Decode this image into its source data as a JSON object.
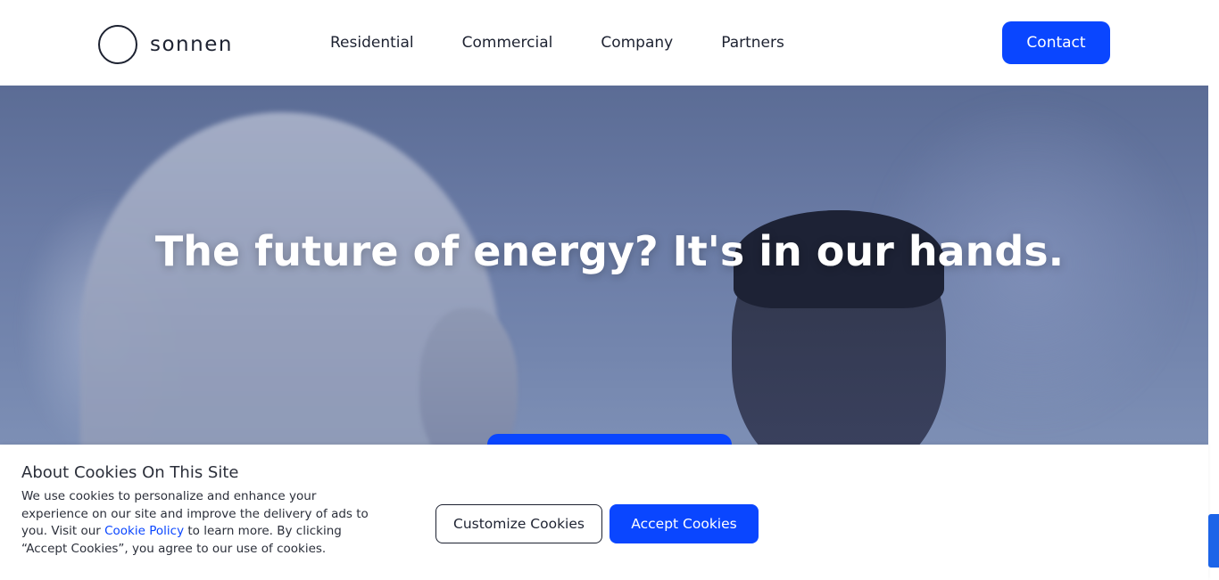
{
  "header": {
    "logo_text": "sonnen",
    "nav": [
      {
        "label": "Residential"
      },
      {
        "label": "Commercial"
      },
      {
        "label": "Company"
      },
      {
        "label": "Partners"
      }
    ],
    "contact_label": "Contact"
  },
  "hero": {
    "headline": "The future of energy? It's in our hands."
  },
  "cookie_banner": {
    "title": "About Cookies On This Site",
    "text_before_link": "We use cookies to personalize and enhance your experience on our site and improve the delivery of ads to you. Visit our ",
    "link_label": "Cookie Policy",
    "text_after_link": " to learn more. By clicking “Accept Cookies”, you agree to our use of cookies.",
    "customize_label": "Customize Cookies",
    "accept_label": "Accept Cookies"
  },
  "colors": {
    "accent": "#0a46ff",
    "text": "#1d2231",
    "hero_sky": "#6a7ba5"
  },
  "icons": {
    "logo": "sonnen-ring-icon"
  }
}
